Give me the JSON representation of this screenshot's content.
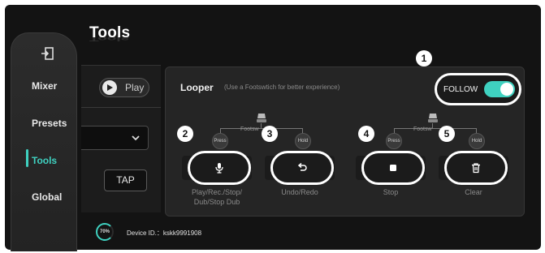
{
  "page": {
    "title": "Tools"
  },
  "sidebar": {
    "items": [
      {
        "label": "Mixer"
      },
      {
        "label": "Presets"
      },
      {
        "label": "Tools"
      },
      {
        "label": "Global"
      }
    ]
  },
  "controls": {
    "play_label": "Play",
    "tap_label": "TAP"
  },
  "looper": {
    "title": "Looper",
    "subtitle": "(Use a Footswtich for better experience)",
    "follow_label": "FOLLOW",
    "follow_on": true,
    "footswitch_label": "Footsw",
    "press_label": "Press",
    "hold_label": "Hold",
    "actions": [
      {
        "label": "Play/Rec./Stop/\nDub/Stop Dub",
        "icon": "microphone-icon"
      },
      {
        "label": "Undo/Redo",
        "icon": "undo-icon"
      },
      {
        "label": "Stop",
        "icon": "stop-icon"
      },
      {
        "label": "Clear",
        "icon": "trash-icon"
      }
    ]
  },
  "badges": [
    "1",
    "2",
    "3",
    "4",
    "5"
  ],
  "footer": {
    "battery": "70%",
    "device_id": "Device ID.：kskk9991908"
  },
  "colors": {
    "accent": "#3fd1c0",
    "background": "#131313",
    "panel": "#252525"
  }
}
